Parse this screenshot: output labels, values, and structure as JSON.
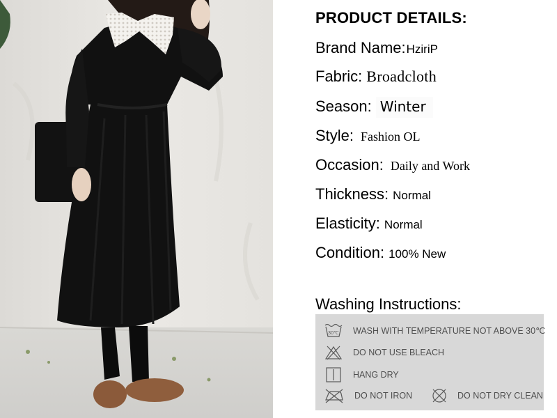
{
  "heading": "PRODUCT DETAILS:",
  "details": [
    {
      "label": "Brand Name:",
      "value": "HziriP"
    },
    {
      "label": "Fabric:",
      "value": "Broadcloth"
    },
    {
      "label": "Season:",
      "value": "Winter"
    },
    {
      "label": "Style:",
      "value": "Fashion OL"
    },
    {
      "label": "Occasion:",
      "value": "Daily and Work"
    },
    {
      "label": "Thickness:",
      "value": "Normal"
    },
    {
      "label": "Elasticity:",
      "value": "Normal"
    },
    {
      "label": "Condition:",
      "value": "100% New"
    }
  ],
  "washing": {
    "title": "Washing Instructions:",
    "items": [
      {
        "icon": "wash-tub-30-icon",
        "icon_text": "30℃",
        "text": "WASH WITH TEMPERATURE NOT ABOVE 30℃"
      },
      {
        "icon": "no-bleach-icon",
        "text": "DO NOT USE BLEACH"
      },
      {
        "icon": "hang-dry-icon",
        "text": "HANG DRY"
      },
      {
        "icon": "no-iron-icon",
        "text": "DO NOT IRON"
      },
      {
        "icon": "no-dry-clean-icon",
        "text": "DO NOT DRY CLEAN"
      }
    ]
  },
  "colors": {
    "panel": "#d8d8d8",
    "panel_text": "#4e4e4e",
    "dress": "#111111",
    "wall": "#e7e5e1"
  }
}
